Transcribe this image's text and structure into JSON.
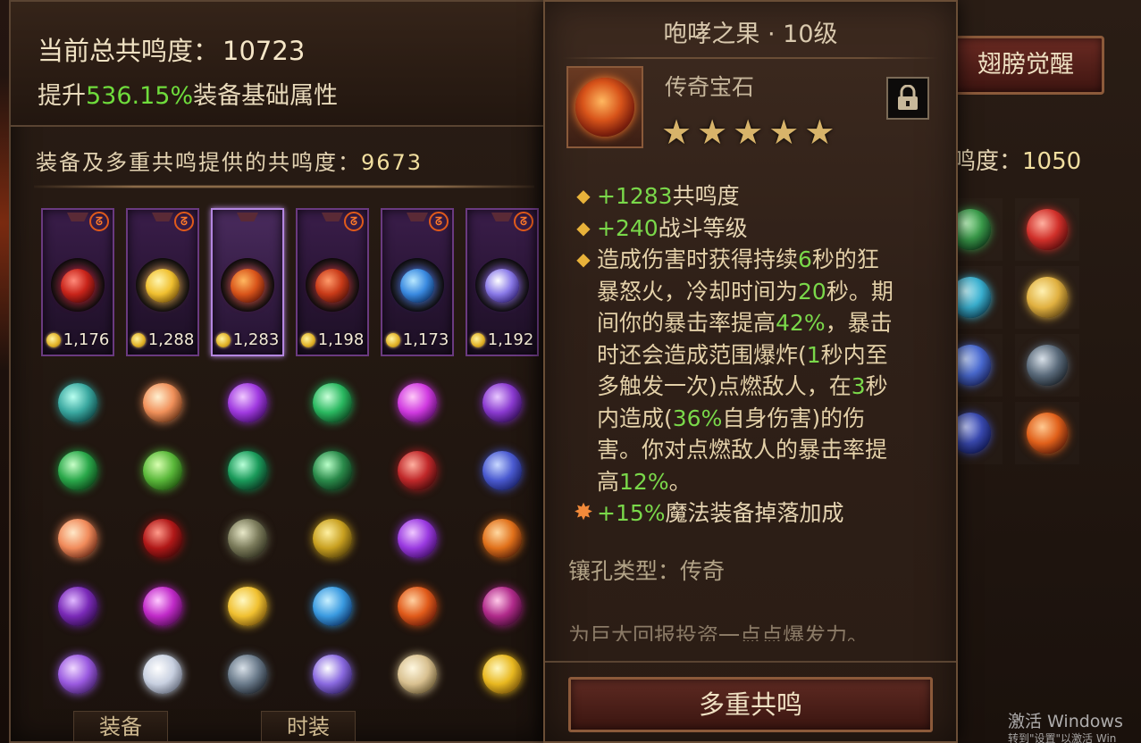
{
  "left_panel": {
    "total_label": "当前总共鸣度：",
    "total_value": "10723",
    "boost_prefix": "提升",
    "boost_percent": "536.15%",
    "boost_suffix": "装备基础属性",
    "equip_label": "装备及多重共鸣提供的共鸣度：",
    "equip_value": "9673",
    "top_cards": [
      {
        "value": "1,176",
        "gem": "red-fire-gem-icon",
        "colors": [
          "#ff8a7a",
          "#c8241a",
          "#4a0808"
        ],
        "emblem": true
      },
      {
        "value": "1,288",
        "gem": "golden-sun-gem-icon",
        "colors": [
          "#fff6b0",
          "#f0c030",
          "#6a4808"
        ],
        "emblem": true
      },
      {
        "value": "1,283",
        "gem": "howling-fruit-gem-icon",
        "colors": [
          "#ffb860",
          "#d8541a",
          "#5a1408"
        ],
        "emblem": false,
        "selected": true
      },
      {
        "value": "1,198",
        "gem": "ember-heart-gem-icon",
        "colors": [
          "#ff9a6a",
          "#c83a18",
          "#4a1008"
        ],
        "emblem": true
      },
      {
        "value": "1,173",
        "gem": "blue-storm-gem-icon",
        "colors": [
          "#b8e8ff",
          "#3a8ae0",
          "#0a2a5a"
        ],
        "emblem": true
      },
      {
        "value": "1,192",
        "gem": "violet-star-gem-icon",
        "colors": [
          "#ffffff",
          "#8a7ae8",
          "#2a1a6a"
        ],
        "emblem": true
      }
    ],
    "emblem_glyph": "ᘔ",
    "grid_gems": [
      {
        "name": "teal-orb-gem-icon",
        "colors": [
          "#b8fff0",
          "#3aa8a0",
          "#0a3a3a"
        ]
      },
      {
        "name": "amber-orb-gem-icon",
        "colors": [
          "#fff0d0",
          "#f0905a",
          "#5a2a10"
        ]
      },
      {
        "name": "purple-heart-gem-icon",
        "colors": [
          "#f0c8ff",
          "#a03ae0",
          "#3a0a5a"
        ]
      },
      {
        "name": "emerald-shard-gem-icon",
        "colors": [
          "#c8ffd8",
          "#2ab860",
          "#0a3a1a"
        ]
      },
      {
        "name": "magenta-orb-gem-icon",
        "colors": [
          "#ffc8f8",
          "#d03ae0",
          "#4a0a5a"
        ]
      },
      {
        "name": "violet-heart-gem-icon",
        "colors": [
          "#e8c8ff",
          "#8a3ad0",
          "#2a0a4a"
        ]
      },
      {
        "name": "green-eye-gem-icon",
        "colors": [
          "#c8ffc8",
          "#2aa84a",
          "#0a3a14"
        ]
      },
      {
        "name": "green-leaf-gem-icon",
        "colors": [
          "#d8ffb0",
          "#5ab83a",
          "#1a4a0a"
        ]
      },
      {
        "name": "jade-orb-gem-icon",
        "colors": [
          "#b8ffd8",
          "#1a9a5a",
          "#0a2a1a"
        ]
      },
      {
        "name": "emerald-crest-gem-icon",
        "colors": [
          "#b8ffc8",
          "#2a8a4a",
          "#0a2a14"
        ]
      },
      {
        "name": "crimson-shard-gem-icon",
        "colors": [
          "#ffb0a0",
          "#c0282a",
          "#3a0808"
        ]
      },
      {
        "name": "sapphire-crest-gem-icon",
        "colors": [
          "#c8d8ff",
          "#4a5ad0",
          "#141a5a"
        ]
      },
      {
        "name": "peach-orb-gem-icon",
        "colors": [
          "#ffe8c8",
          "#f08a5a",
          "#5a2010"
        ]
      },
      {
        "name": "blood-crest-gem-icon",
        "colors": [
          "#ff9a8a",
          "#b01818",
          "#3a0606"
        ]
      },
      {
        "name": "dragon-eye-gem-icon",
        "colors": [
          "#e8e8c8",
          "#7a7a5a",
          "#2a2a1a"
        ]
      },
      {
        "name": "golden-vine-gem-icon",
        "colors": [
          "#fff0a0",
          "#c8a020",
          "#4a3808"
        ]
      },
      {
        "name": "amethyst-heart-gem-icon",
        "colors": [
          "#f0c8ff",
          "#9a3ae0",
          "#3a0a5a"
        ]
      },
      {
        "name": "flame-crest-gem-icon",
        "colors": [
          "#ffd8a0",
          "#e0701a",
          "#4a1a08"
        ]
      },
      {
        "name": "void-purple-gem-icon",
        "colors": [
          "#e0b8ff",
          "#7a2ab8",
          "#2a0a40"
        ]
      },
      {
        "name": "magenta-pearl-gem-icon",
        "colors": [
          "#ffc8ff",
          "#c02ac8",
          "#4a0a4a"
        ]
      },
      {
        "name": "sun-gold-gem-icon",
        "colors": [
          "#fff8c0",
          "#f0c030",
          "#6a4808"
        ]
      },
      {
        "name": "azure-swirl-gem-icon",
        "colors": [
          "#c8f0ff",
          "#3a9ae0",
          "#0a2a5a"
        ]
      },
      {
        "name": "lava-ring-gem-icon",
        "colors": [
          "#ffd0a0",
          "#e05a1a",
          "#5a1408"
        ]
      },
      {
        "name": "plum-orb-gem-icon",
        "colors": [
          "#ffc8e8",
          "#b02a8a",
          "#3a0a2a"
        ]
      },
      {
        "name": "lilac-orb-gem-icon",
        "colors": [
          "#f0d8ff",
          "#9a5ae0",
          "#3a1a5a"
        ]
      },
      {
        "name": "pearl-ring-gem-icon",
        "colors": [
          "#ffffff",
          "#c8d0e0",
          "#5a6070"
        ]
      },
      {
        "name": "steel-orb-gem-icon",
        "colors": [
          "#d8e0e8",
          "#6a7a8a",
          "#1a2028"
        ]
      },
      {
        "name": "violet-burst-gem-icon",
        "colors": [
          "#ffffff",
          "#8a6ae0",
          "#2a1a5a"
        ]
      },
      {
        "name": "ivory-crest-gem-icon",
        "colors": [
          "#fff8e0",
          "#d8c090",
          "#5a4a28"
        ]
      },
      {
        "name": "golden-orb-gem-icon",
        "colors": [
          "#fff8c0",
          "#e8b820",
          "#6a4808"
        ]
      }
    ],
    "tabs": [
      "装备",
      "时装"
    ]
  },
  "right_panel": {
    "awaken_label": "翅膀觉醒",
    "res_label": "鸣度：",
    "res_value": "1050",
    "gems": [
      {
        "name": "green-vine-gem-icon",
        "colors": [
          "#c8ffc8",
          "#3a9a4a",
          "#0a2a14"
        ]
      },
      {
        "name": "ruby-orb-gem-icon",
        "colors": [
          "#ffb0a0",
          "#d0302a",
          "#4a0808"
        ]
      },
      {
        "name": "cyan-shard-gem-icon",
        "colors": [
          "#c8f8ff",
          "#3ab0d0",
          "#0a3040"
        ]
      },
      {
        "name": "golden-crest-gem-icon",
        "colors": [
          "#fff0b0",
          "#e0b040",
          "#5a4010"
        ]
      },
      {
        "name": "blue-vortex-gem-icon",
        "colors": [
          "#c8d8ff",
          "#4a6ad0",
          "#141a4a"
        ]
      },
      {
        "name": "slate-orb-gem-icon",
        "colors": [
          "#d8e0e8",
          "#5a6a7a",
          "#141a20"
        ]
      },
      {
        "name": "indigo-orb-gem-icon",
        "colors": [
          "#c8d0ff",
          "#3a4ab0",
          "#0a1040"
        ]
      },
      {
        "name": "fire-fruit-gem-icon",
        "colors": [
          "#ffc890",
          "#e0601a",
          "#4a1408"
        ]
      }
    ]
  },
  "tooltip": {
    "title": "咆哮之果 · 10级",
    "type": "传奇宝石",
    "stars": 5,
    "stats": [
      {
        "num": "+1283",
        "text": " 共鸣度",
        "bullet": "◆"
      },
      {
        "num": "+240",
        "text": " 战斗等级",
        "bullet": "◆"
      }
    ],
    "effect": {
      "bullet": "◆",
      "lines": [
        [
          {
            "t": "造成伤害时获得持续"
          },
          {
            "t": "6",
            "hl": true
          },
          {
            "t": "秒的狂"
          }
        ],
        [
          {
            "t": "暴怒火，冷却时间为"
          },
          {
            "t": "20",
            "hl": true
          },
          {
            "t": "秒。期"
          }
        ],
        [
          {
            "t": "间你的暴击率提高"
          },
          {
            "t": "42%",
            "hl": true
          },
          {
            "t": "，暴击"
          }
        ],
        [
          {
            "t": "时还会造成范围爆炸("
          },
          {
            "t": "1",
            "hl": true
          },
          {
            "t": "秒内至"
          }
        ],
        [
          {
            "t": "多触发一次)点燃敌人，在"
          },
          {
            "t": "3",
            "hl": true
          },
          {
            "t": "秒"
          }
        ],
        [
          {
            "t": "内造成("
          },
          {
            "t": "36%",
            "hl": true
          },
          {
            "t": "自身伤害)的伤"
          }
        ],
        [
          {
            "t": "害。你对点燃敌人的暴击率提"
          }
        ],
        [
          {
            "t": "高"
          },
          {
            "t": "12%",
            "hl": true
          },
          {
            "t": "。"
          }
        ]
      ]
    },
    "bonus": {
      "num": "+15%",
      "text": " 魔法装备掉落加成",
      "bullet": "✸"
    },
    "socket_label": "镶孔类型：传奇",
    "flavor": "为巨大回报投资一点点爆发力。",
    "resonance_button": "多重共鸣"
  },
  "watermark": {
    "line1": "激活 Windows",
    "line2": "转到\"设置\"以激活 Win"
  }
}
